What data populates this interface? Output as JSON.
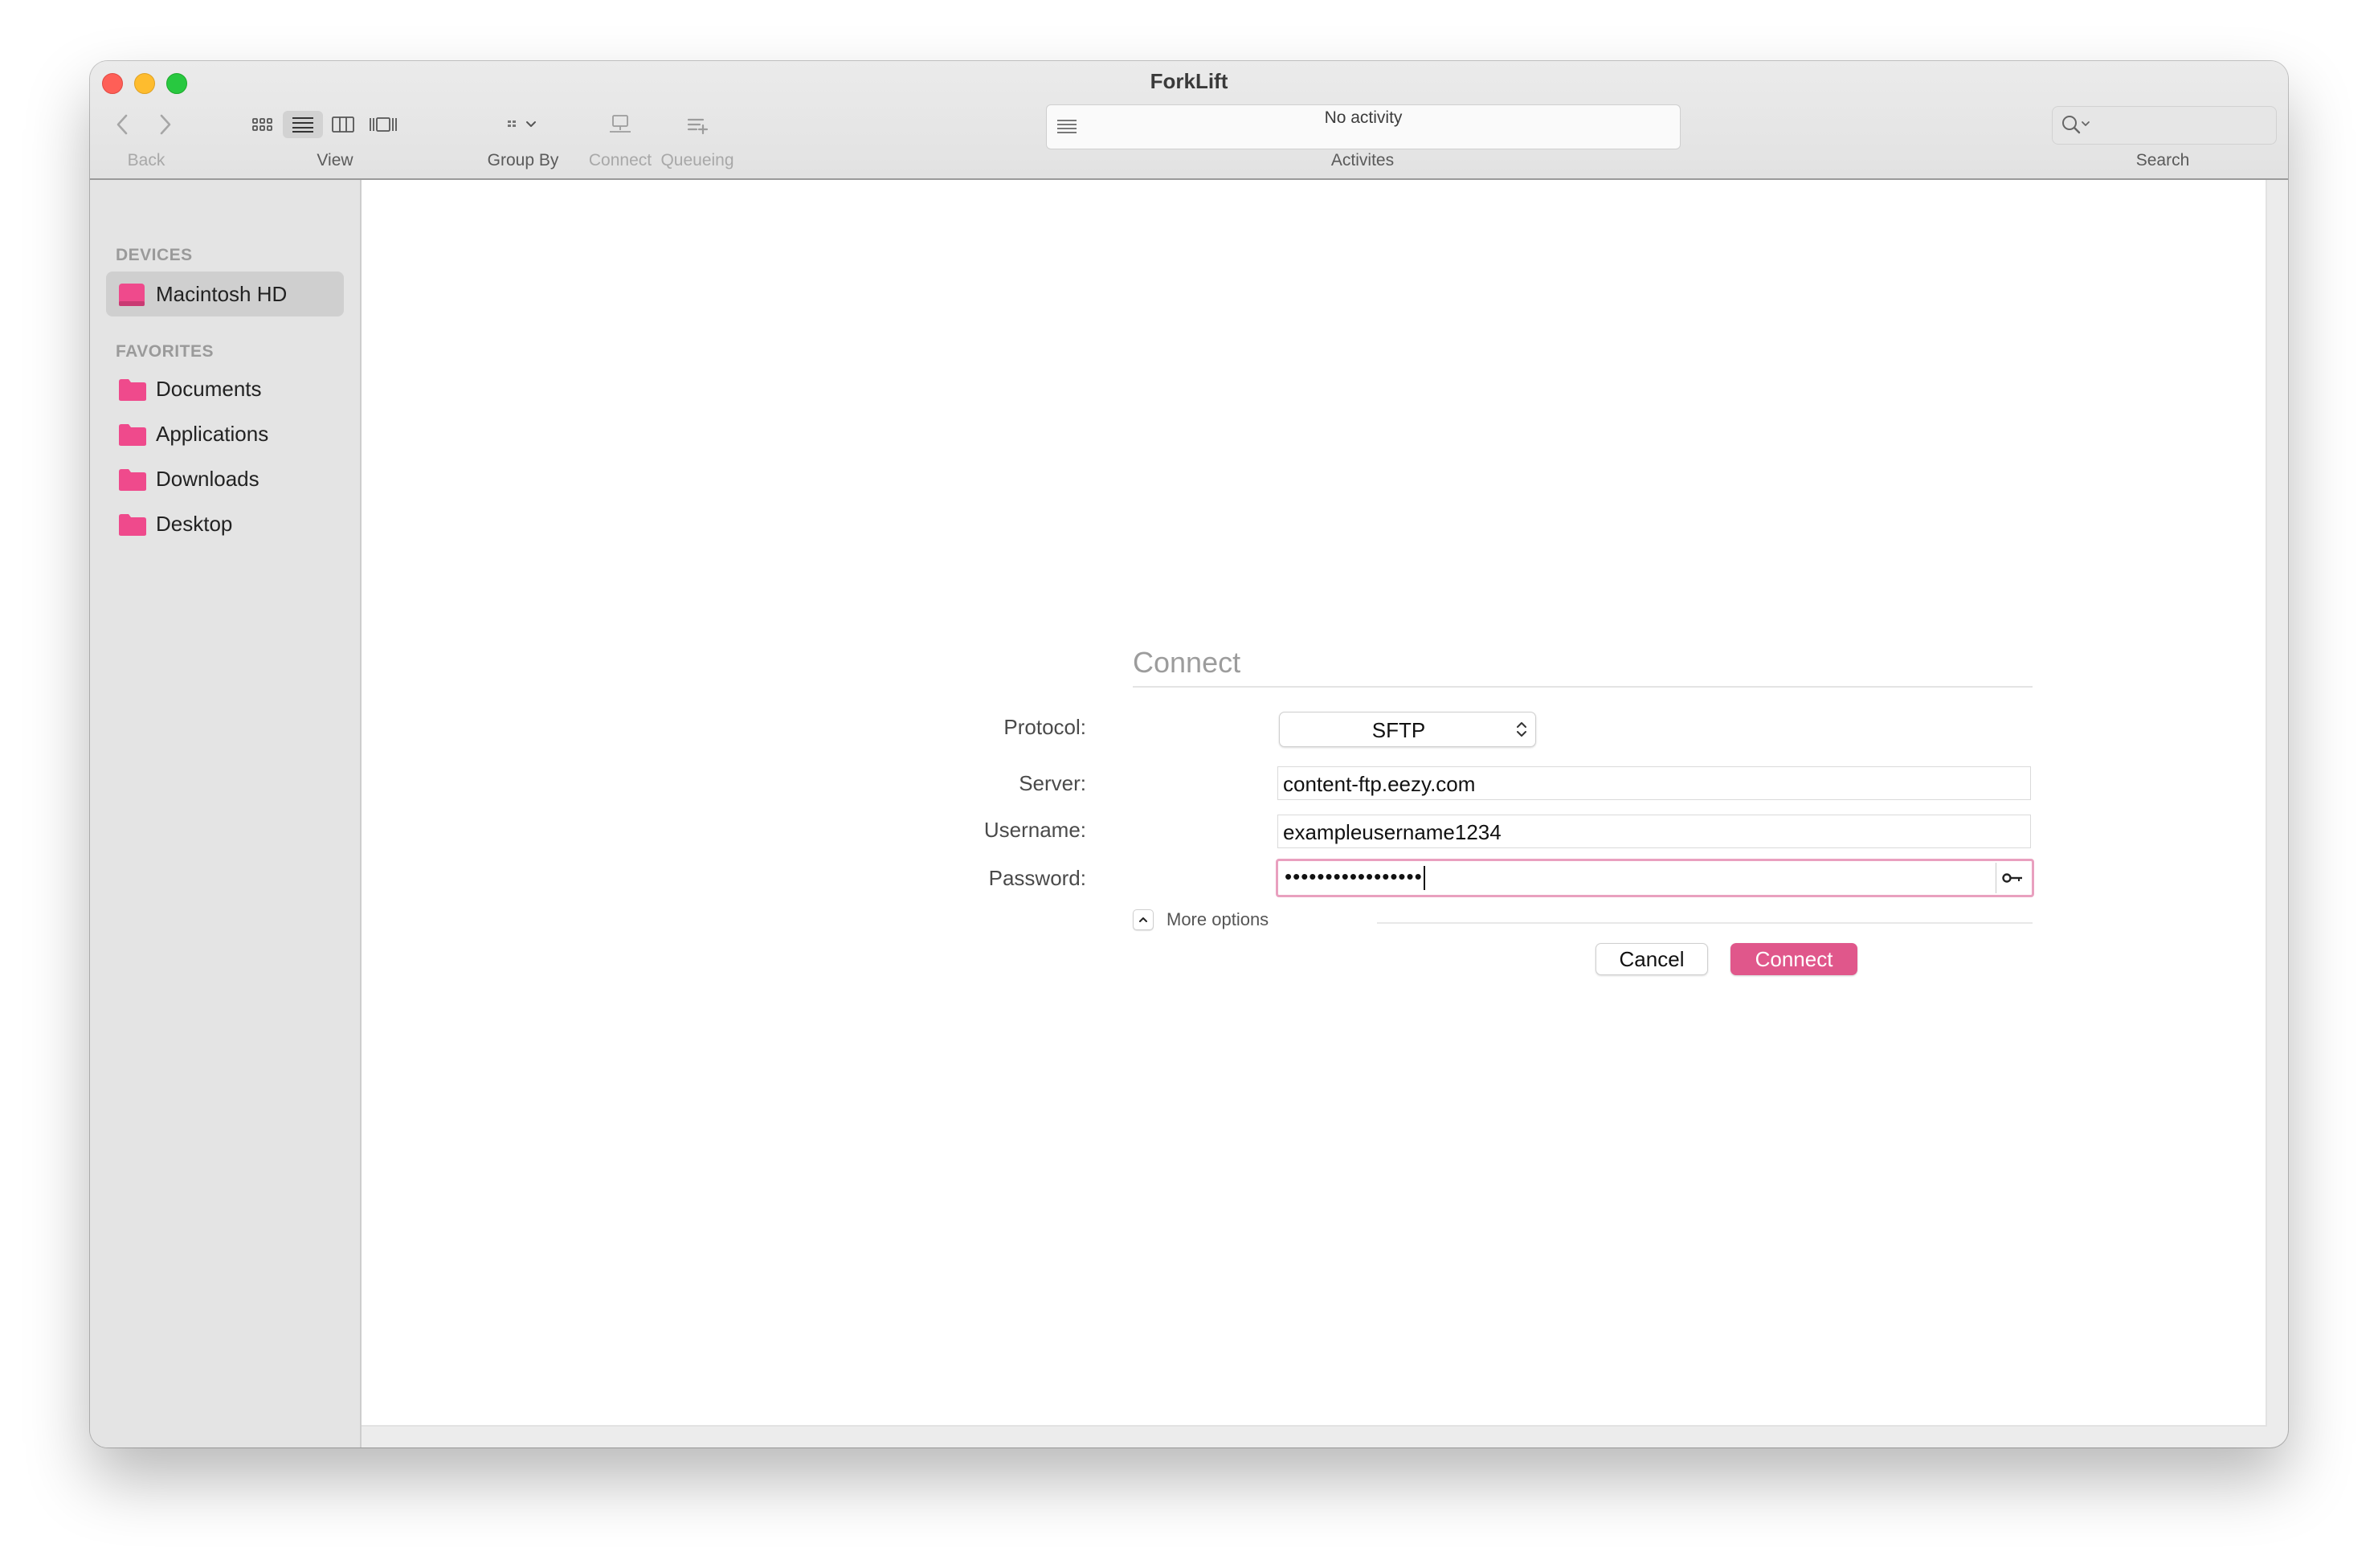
{
  "window": {
    "title": "ForkLift"
  },
  "toolbar": {
    "back_label": "Back",
    "view_label": "View",
    "group_by_label": "Group By",
    "connect_label": "Connect",
    "queueing_label": "Queueing",
    "activities_label": "Activites",
    "activity_status": "No activity",
    "search_label": "Search",
    "search_placeholder": ""
  },
  "sidebar": {
    "devices_header": "DEVICES",
    "devices": [
      {
        "label": "Macintosh HD",
        "icon": "drive-icon",
        "selected": true
      }
    ],
    "favorites_header": "FAVORITES",
    "favorites": [
      {
        "label": "Documents",
        "icon": "folder-icon"
      },
      {
        "label": "Applications",
        "icon": "folder-icon"
      },
      {
        "label": "Downloads",
        "icon": "folder-icon"
      },
      {
        "label": "Desktop",
        "icon": "folder-icon"
      }
    ]
  },
  "connect_dialog": {
    "title": "Connect",
    "protocol_label": "Protocol:",
    "protocol_value": "SFTP",
    "server_label": "Server:",
    "server_value": "content-ftp.eezy.com",
    "username_label": "Username:",
    "username_value": "exampleusername1234",
    "password_label": "Password:",
    "password_value": "•••••••••••••••••",
    "more_options_label": "More options",
    "cancel_label": "Cancel",
    "connect_label": "Connect"
  },
  "colors": {
    "accent": "#e0578b",
    "folder": "#ef4a8c",
    "focus_ring": "#e9a0bf"
  }
}
